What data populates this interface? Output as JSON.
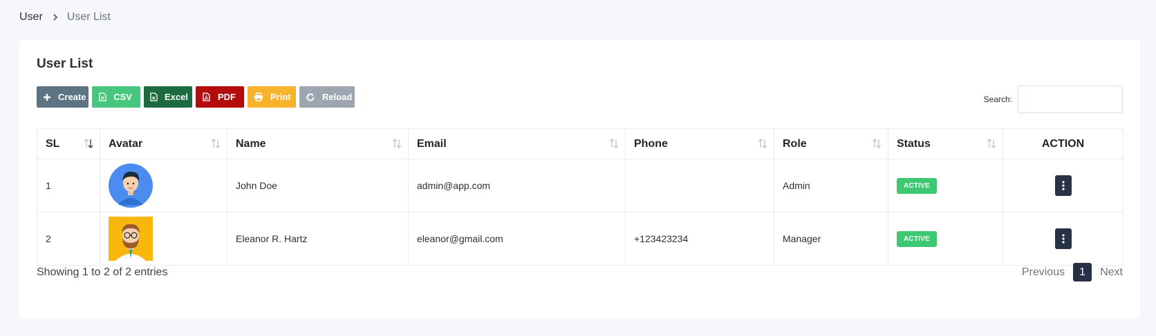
{
  "breadcrumb": {
    "root": "User",
    "current": "User List"
  },
  "card": {
    "title": "User List"
  },
  "toolbar": {
    "create": "Create",
    "csv": "CSV",
    "excel": "Excel",
    "pdf": "PDF",
    "print": "Print",
    "reload": "Reload"
  },
  "search": {
    "label": "Search:",
    "value": ""
  },
  "table": {
    "headers": [
      "SL",
      "Avatar",
      "Name",
      "Email",
      "Phone",
      "Role",
      "Status",
      "ACTION"
    ],
    "rows": [
      {
        "sl": "1",
        "avatar": "boy-avatar",
        "name": "John Doe",
        "email": "admin@app.com",
        "phone": "",
        "role": "Admin",
        "status": "ACTIVE"
      },
      {
        "sl": "2",
        "avatar": "bearded-man-avatar",
        "name": "Eleanor R. Hartz",
        "email": "eleanor@gmail.com",
        "phone": "+123423234",
        "role": "Manager",
        "status": "ACTIVE"
      }
    ]
  },
  "footer": {
    "info": "Showing 1 to 2 of 2 entries"
  },
  "pagination": {
    "previous": "Previous",
    "current": "1",
    "next": "Next"
  },
  "colors": {
    "create": "#5d7484",
    "csv": "#46c77d",
    "excel": "#1f6b41",
    "pdf": "#b40c0c",
    "print": "#f6b32b",
    "reload": "#9ca5b0",
    "status_active": "#3ec874",
    "pager_active": "#283047"
  }
}
